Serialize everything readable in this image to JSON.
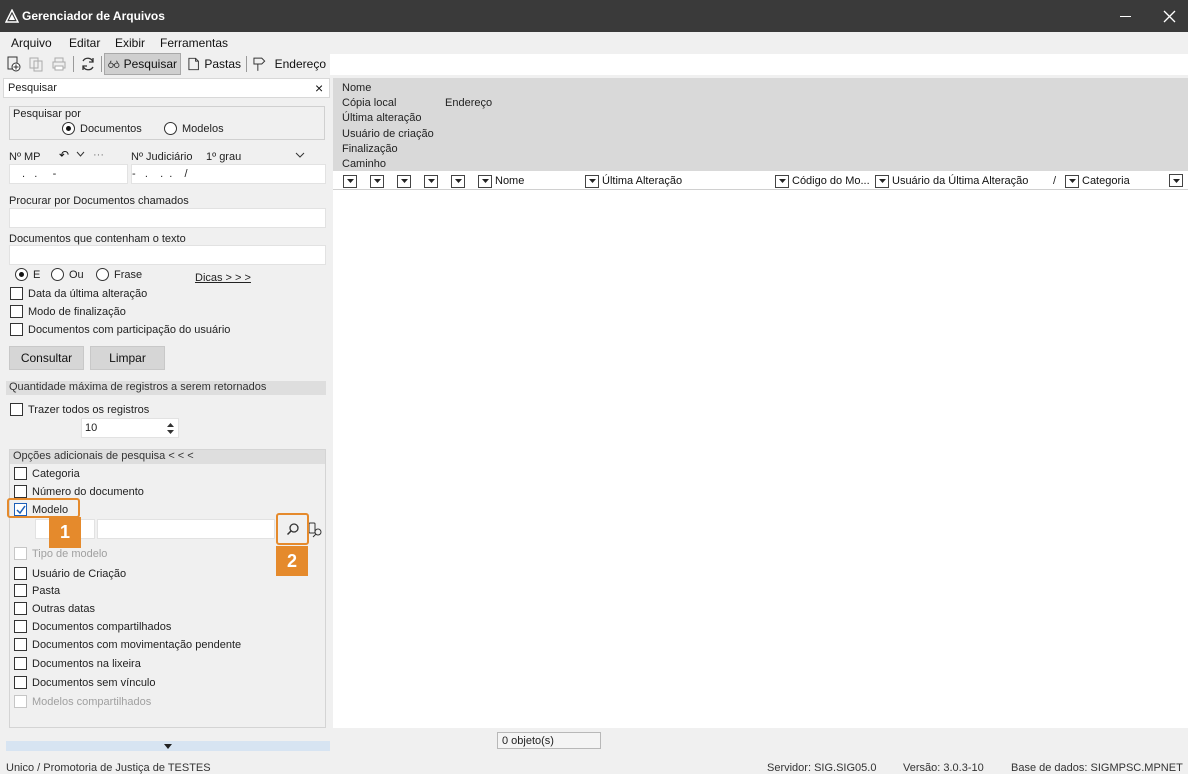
{
  "window": {
    "title": "Gerenciador de Arquivos"
  },
  "menu": [
    "Arquivo",
    "Editar",
    "Exibir",
    "Ferramentas"
  ],
  "toolbar": {
    "search_label": "Pesquisar",
    "folders_label": "Pastas",
    "address_label": "Endereço"
  },
  "search_panel": {
    "title": "Pesquisar",
    "search_by_label": "Pesquisar por",
    "search_by_options": [
      "Documentos",
      "Modelos"
    ],
    "mp_label": "Nº MP",
    "mp_value": " .   .     -",
    "judicial_label": "Nº Judiciário",
    "judicial_grade": "1º grau",
    "judicial_value": "-   .    .  .    /",
    "ellipsis": "···",
    "docs_named_label": "Procurar por Documentos chamados",
    "docs_text_label": "Documentos que contenham o texto",
    "match_options": [
      "E",
      "Ou",
      "Frase"
    ],
    "tips_link": "Dicas > > >",
    "checks": [
      "Data da última alteração",
      "Modo de finalização",
      "Documentos com participação do usuário"
    ],
    "query_button": "Consultar",
    "clear_button": "Limpar",
    "max_records_label": "Quantidade máxima de registros a serem retornados",
    "bring_all_label": "Trazer todos os registros",
    "max_records_value": "10",
    "extra_options_label": "Opções adicionais de pesquisa < < <",
    "extra_options": [
      {
        "label": "Categoria",
        "checked": false,
        "disabled": false
      },
      {
        "label": "Número do documento",
        "checked": false,
        "disabled": false
      },
      {
        "label": "Modelo",
        "checked": true,
        "disabled": false
      },
      {
        "label": "Tipo de modelo",
        "checked": false,
        "disabled": true
      },
      {
        "label": "Usuário de Criação",
        "checked": false,
        "disabled": false
      },
      {
        "label": "Pasta",
        "checked": false,
        "disabled": false
      },
      {
        "label": "Outras datas",
        "checked": false,
        "disabled": false
      },
      {
        "label": "Documentos compartilhados",
        "checked": false,
        "disabled": false
      },
      {
        "label": "Documentos com movimentação pendente",
        "checked": false,
        "disabled": false
      },
      {
        "label": "Documentos na lixeira",
        "checked": false,
        "disabled": false
      },
      {
        "label": "Documentos sem vínculo",
        "checked": false,
        "disabled": false
      },
      {
        "label": "Modelos compartilhados",
        "checked": false,
        "disabled": true
      }
    ],
    "badge1": "1",
    "badge2": "2"
  },
  "details": {
    "name": "Nome",
    "local_copy": "Cópia local",
    "address": "Endereço",
    "last_change": "Última alteração",
    "creator": "Usuário de criação",
    "finalization": "Finalização",
    "path": "Caminho"
  },
  "columns": [
    "Nome",
    "Última Alteração",
    "Código do Mo...",
    "Usuário da Última Alteração",
    "Categoria"
  ],
  "sort_marker": "/",
  "object_count": "0 objeto(s)",
  "status": {
    "org": "Unico / Promotoria de Justiça de TESTES",
    "server": "Servidor: SIG.SIG05.0",
    "version": "Versão: 3.0.3-10",
    "database": "Base de dados: SIGMPSC.MPNET"
  },
  "colors": {
    "titlebar": "#3a3a3a",
    "highlight": "#e58a2c",
    "check_blue": "#1d5fb8"
  }
}
